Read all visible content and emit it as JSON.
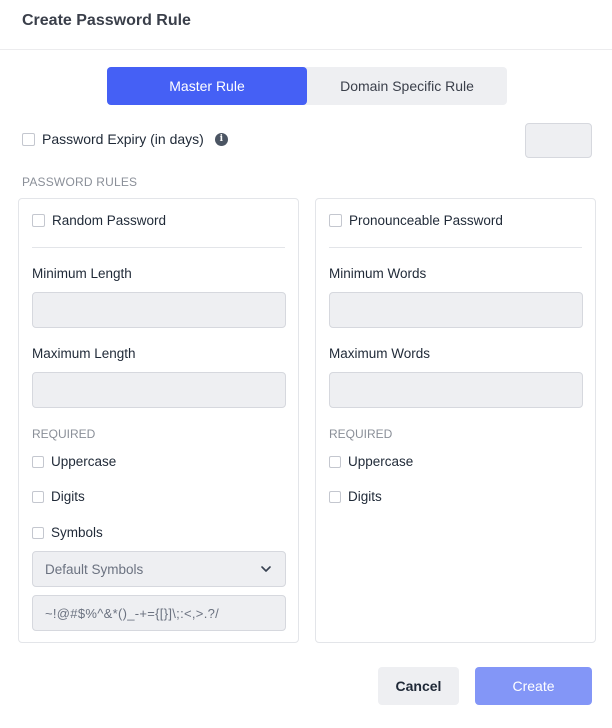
{
  "dialog": {
    "title": "Create Password Rule"
  },
  "tabs": [
    {
      "label": "Master Rule",
      "active": true
    },
    {
      "label": "Domain Specific Rule",
      "active": false
    }
  ],
  "expiry": {
    "label": "Password Expiry (in days)",
    "info_icon": "info-icon",
    "value": ""
  },
  "section_title": "PASSWORD RULES",
  "left_panel": {
    "checkbox_label": "Random Password",
    "min_label": "Minimum Length",
    "min_value": "",
    "max_label": "Maximum Length",
    "max_value": "",
    "required_title": "REQUIRED",
    "required_items": [
      "Uppercase",
      "Digits",
      "Symbols"
    ],
    "symbols_select": "Default Symbols",
    "symbols_value": "~!@#$%^&*()_-+={[}]\\;:<,>.?/"
  },
  "right_panel": {
    "checkbox_label": "Pronounceable Password",
    "min_label": "Minimum Words",
    "min_value": "",
    "max_label": "Maximum Words",
    "max_value": "",
    "required_title": "REQUIRED",
    "required_items": [
      "Uppercase",
      "Digits"
    ]
  },
  "footer": {
    "cancel_label": "Cancel",
    "create_label": "Create"
  },
  "colors": {
    "accent": "#4560f5",
    "create_disabled": "#8396f7",
    "input_bg": "#eeeff2"
  }
}
